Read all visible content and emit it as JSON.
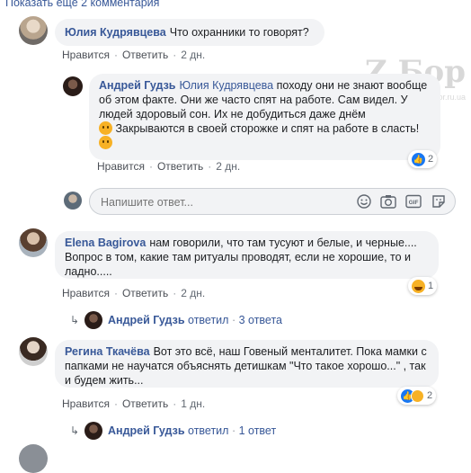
{
  "top": {
    "show_more": "Показать еще 2 комментария"
  },
  "watermark": {
    "text": "Z Бор",
    "url": "zbor.ru.ua"
  },
  "comments": [
    {
      "author": "Юлия Кудрявцева",
      "text": "Что охранники то говорят?",
      "like": "Нравится",
      "reply": "Ответить",
      "time": "2 дн.",
      "replies": [
        {
          "author": "Андрей Гудзь",
          "mention": "Юлия Кудрявцева",
          "text": "походу они не знают вообще об этом факте. Они же часто спят на работе. Сам видел. У людей здоровый сон. Их не добудиться даже днём",
          "text2": "Закрываются в своей сторожке и спят на работе в сласть!",
          "like": "Нравится",
          "reply": "Ответить",
          "time": "2 дн.",
          "reaction_count": "2"
        }
      ]
    },
    {
      "author": "Elena Bagirova",
      "text": "нам говорили, что там тусуют и белые, и черные.... Вопрос в том, какие там ритуалы проводят, если не хорошие, то и ладно.....",
      "like": "Нравится",
      "reply": "Ответить",
      "time": "2 дн.",
      "reaction_count": "1",
      "reply_author": "Андрей Гудзь",
      "reply_verb": "ответил",
      "reply_count": "3 ответа"
    },
    {
      "author": "Регина Ткачёва",
      "text": "Вот это всё, наш Говеный менталитет. Пока мамки с папками не научатся объяснять детишкам \"Что такое хорошо...\" , так и будем жить...",
      "like": "Нравится",
      "reply": "Ответить",
      "time": "1 дн.",
      "reaction_count": "2",
      "reply_author": "Андрей Гудзь",
      "reply_verb": "ответил",
      "reply_count": "1 ответ"
    }
  ],
  "reply_input": {
    "placeholder": "Напишите ответ..."
  },
  "colors": {
    "link": "#385898",
    "bubble": "#f2f3f5",
    "like_blue": "#1877f2",
    "emoji": "#f7b125"
  }
}
